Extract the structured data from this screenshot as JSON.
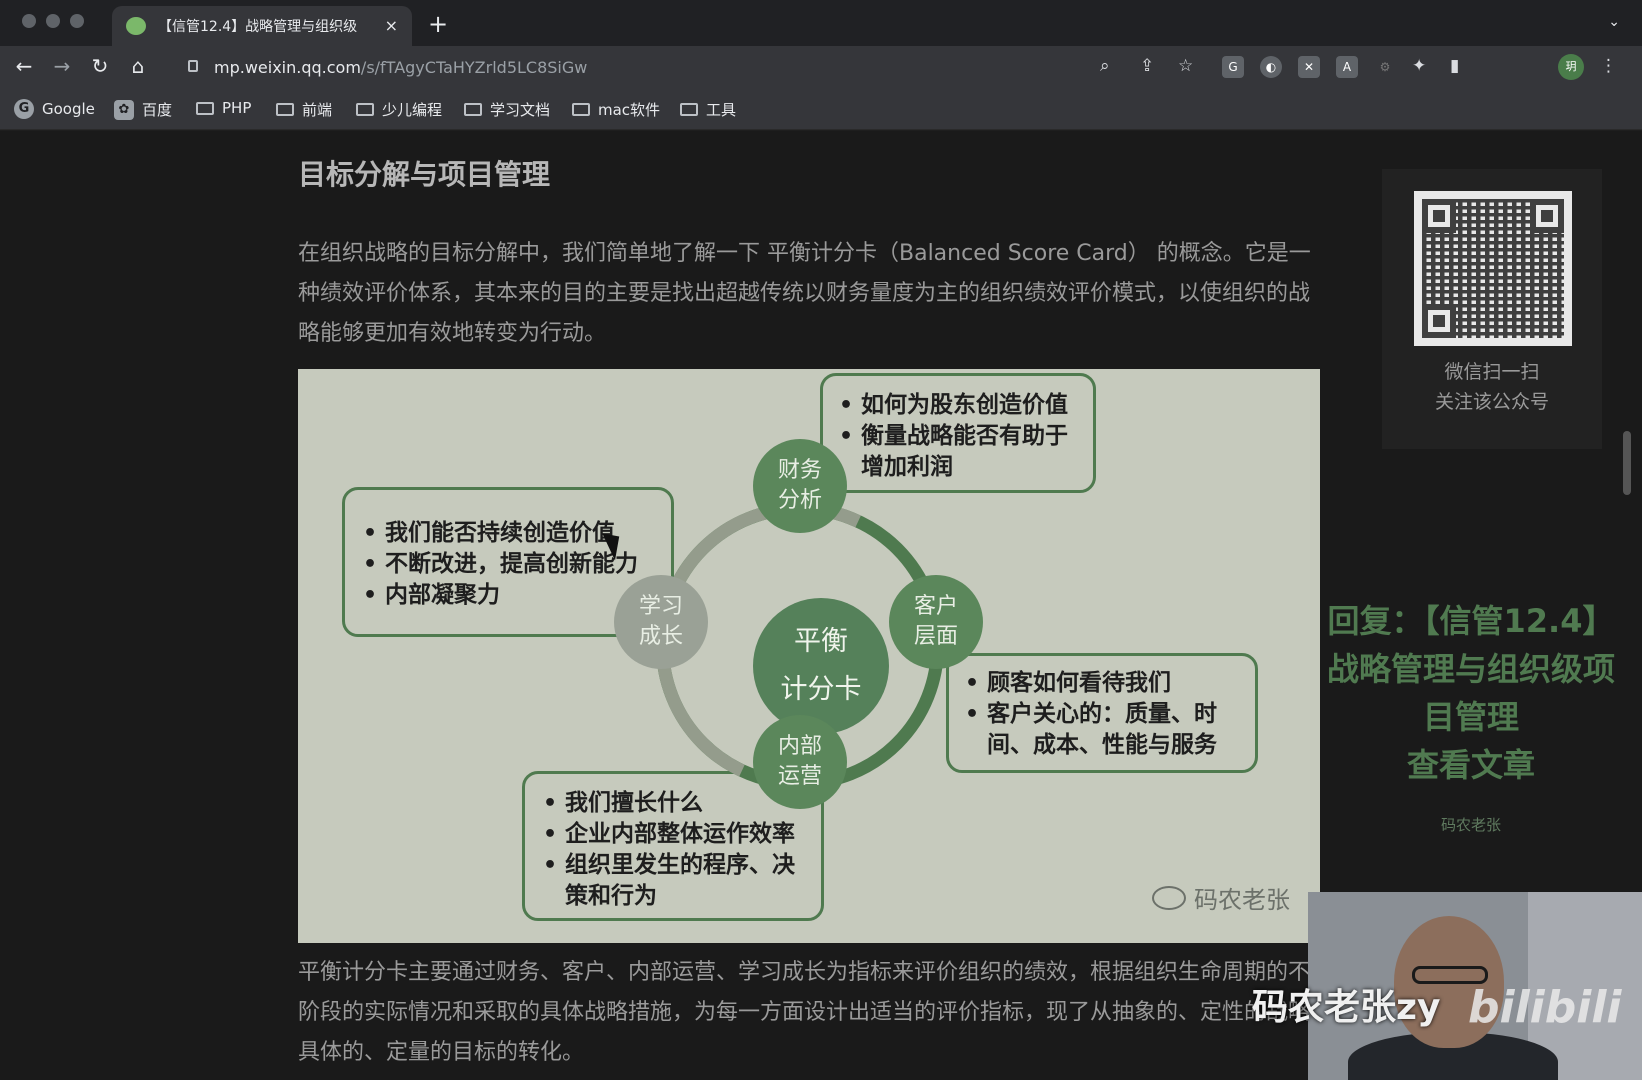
{
  "browser": {
    "tab_title": "【信管12.4】战略管理与组织级",
    "url_host": "mp.weixin.qq.com",
    "url_path": "/s/fTAgyCTaHYZrld5LC8SiGw",
    "new_tab": "+",
    "tab_close": "×",
    "avatar": "玥"
  },
  "bookmarks": [
    "Google",
    "百度",
    "PHP",
    "前端",
    "少儿编程",
    "学习文档",
    "mac软件",
    "工具"
  ],
  "article": {
    "heading": "目标分解与项目管理",
    "para1": "在组织战略的目标分解中，我们简单地了解一下 平衡计分卡（Balanced Score Card） 的概念。它是一种绩效评价体系，其本来的目的主要是找出超越传统以财务量度为主的组织绩效评价模式，以使组织的战略能够更加有效地转变为行动。",
    "para2": "平衡计分卡主要通过财务、客户、内部运营、学习成长为指标来评价组织的绩效，根据组织生命周期的不同阶段的实际情况和采取的具体战略措施，为每一方面设计出适当的评价指标，现了从抽象的、定性的战略到具体的、定量的目标的转化。"
  },
  "diagram": {
    "center": [
      "平衡",
      "计分卡"
    ],
    "nodes": {
      "finance": [
        "财务",
        "分析"
      ],
      "customer": [
        "客户",
        "层面"
      ],
      "internal": [
        "内部",
        "运营"
      ],
      "learning": [
        "学习",
        "成长"
      ]
    },
    "finance_points": [
      "如何为股东创造价值",
      "衡量战略能否有助于增加利润"
    ],
    "learning_points": [
      "我们能否持续创造价值",
      "不断改进，提高创新能力",
      "内部凝聚力"
    ],
    "customer_points": [
      "顾客如何看待我们",
      "客户关心的：质量、时间、成本、性能与服务"
    ],
    "internal_points": [
      "我们擅长什么",
      "企业内部整体运作效率",
      "组织里发生的程序、决策和行为"
    ],
    "watermark": "码农老张"
  },
  "sidebar": {
    "qr_caption": [
      "微信扫一扫",
      "关注该公众号"
    ],
    "promo": [
      "回复：【信管12.4】",
      "战略管理与组织级项",
      "目管理",
      "查看文章"
    ],
    "promo_author": "码农老张"
  },
  "overlay": {
    "cam_label": "码农老张zy",
    "bili": "bilibili"
  }
}
